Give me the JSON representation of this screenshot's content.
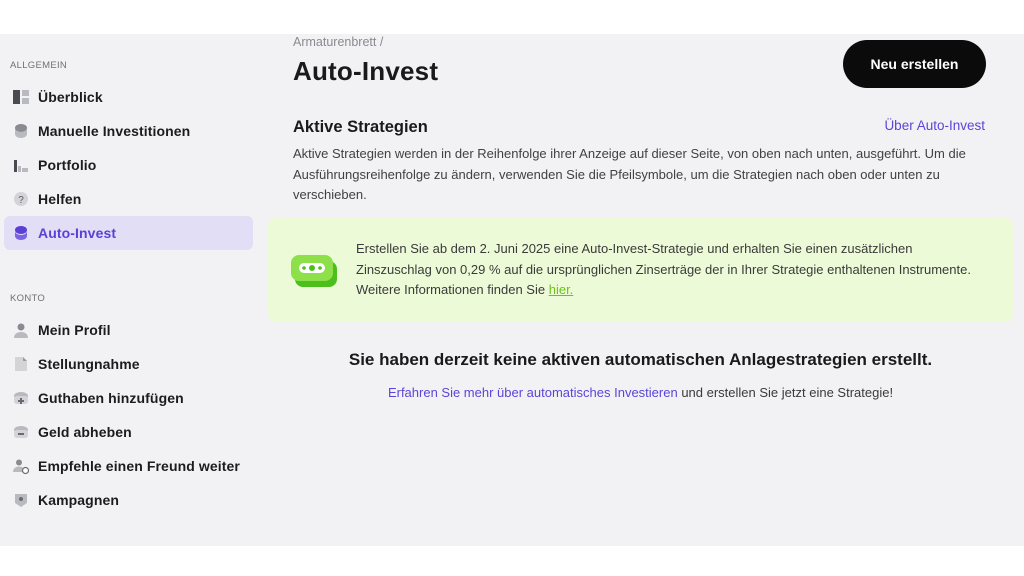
{
  "sidebar": {
    "general_label": "ALLGEMEIN",
    "account_label": "KONTO",
    "general_items": [
      {
        "label": "Überblick",
        "icon": "dashboard-icon"
      },
      {
        "label": "Manuelle Investitionen",
        "icon": "coins-icon"
      },
      {
        "label": "Portfolio",
        "icon": "bar-chart-icon"
      },
      {
        "label": "Helfen",
        "icon": "help-icon"
      },
      {
        "label": "Auto-Invest",
        "icon": "auto-invest-icon",
        "active": true
      }
    ],
    "account_items": [
      {
        "label": "Mein Profil",
        "icon": "user-icon"
      },
      {
        "label": "Stellungnahme",
        "icon": "document-icon"
      },
      {
        "label": "Guthaben hinzufügen",
        "icon": "wallet-add-icon"
      },
      {
        "label": "Geld abheben",
        "icon": "wallet-withdraw-icon"
      },
      {
        "label": "Empfehle einen Freund weiter",
        "icon": "refer-friend-icon"
      },
      {
        "label": "Kampagnen",
        "icon": "campaign-icon"
      }
    ]
  },
  "main": {
    "breadcrumb": "Armaturenbrett /",
    "title": "Auto-Invest",
    "new_button": "Neu erstellen",
    "section_title": "Aktive Strategien",
    "about_link": "Über Auto-Invest",
    "description": "Aktive Strategien werden in der Reihenfolge ihrer Anzeige auf dieser Seite, von oben nach unten, ausgeführt. Um die Ausführungsreihenfolge zu ändern, verwenden Sie die Pfeilsymbole, um die Strategien nach oben oder unten zu verschieben.",
    "promo": {
      "text": "Erstellen Sie ab dem 2. Juni 2025 eine Auto-Invest-Strategie und erhalten Sie einen zusätzlichen Zinszuschlag von 0,29 % auf die ursprünglichen Zinserträge der in Ihrer Strategie enthaltenen Instrumente. Weitere Informationen finden Sie",
      "link": "hier.",
      "icon": "money-icon"
    },
    "empty_title": "Sie haben derzeit keine aktiven automatischen Anlagestrategien erstellt.",
    "empty_link": "Erfahren Sie mehr über automatisches Investieren",
    "empty_suffix": " und erstellen Sie jetzt eine Strategie!"
  },
  "colors": {
    "accent": "#5b45d8",
    "active_bg": "#e1def6",
    "promo_bg": "#edfad7",
    "promo_link": "#6cc21b",
    "button_bg": "#0b0b0b"
  }
}
